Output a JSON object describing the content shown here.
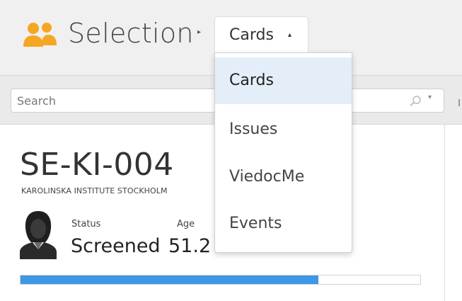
{
  "header": {
    "title": "Selection",
    "breadcrumb_separator": "▸",
    "view_dropdown": {
      "label": "Cards",
      "caret": "▴"
    }
  },
  "toolbar": {
    "search": {
      "placeholder": "Search",
      "value": "",
      "caret": "▾"
    }
  },
  "dropdown_menu": {
    "items": [
      {
        "label": "Cards",
        "selected": true
      },
      {
        "label": "Issues",
        "selected": false
      },
      {
        "label": "ViedocMe",
        "selected": false
      },
      {
        "label": "Events",
        "selected": false
      }
    ]
  },
  "subject": {
    "id": "SE-KI-004",
    "site": "KAROLINSKA INSTITUTE STOCKHOLM",
    "status_label": "Status",
    "status_value": "Screened",
    "age_label": "Age",
    "age_value": "51.2",
    "progress_fraction": 0.745
  },
  "icons": {
    "header": "users-icon",
    "search": "search-icon",
    "avatar": "avatar-female-icon"
  },
  "colors": {
    "accent_icon": "#f5a623",
    "progress": "#3d97e5",
    "menu_selected": "#e3eef9"
  }
}
